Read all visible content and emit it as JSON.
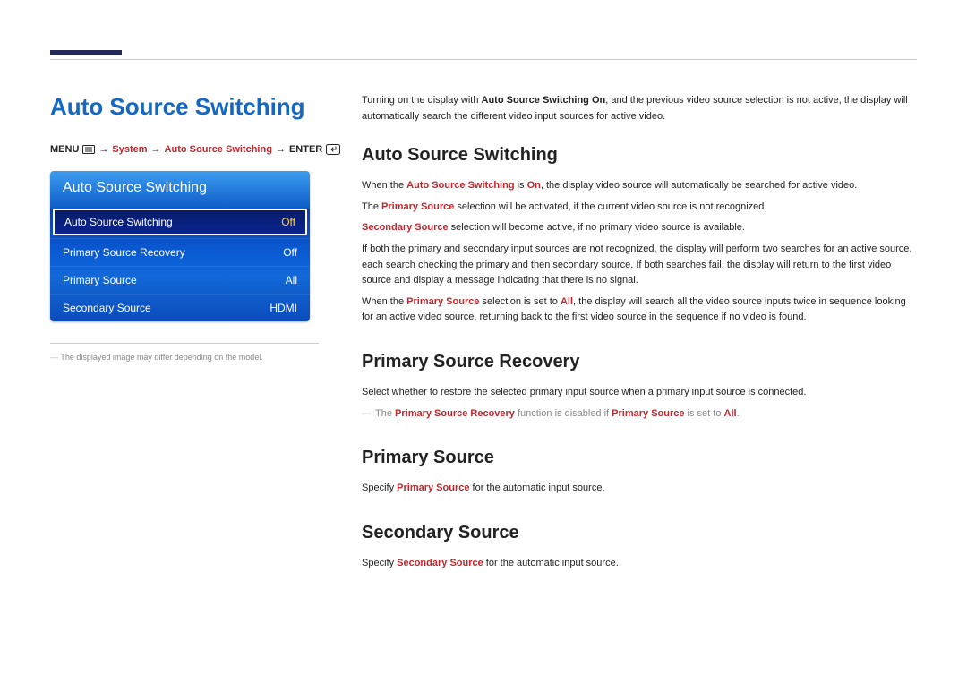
{
  "page_title": "Auto Source Switching",
  "breadcrumb": {
    "menu": "MENU",
    "arrow": "→",
    "system": "System",
    "item": "Auto Source Switching",
    "enter": "ENTER"
  },
  "osd": {
    "header": "Auto Source Switching",
    "rows": [
      {
        "label": "Auto Source Switching",
        "value": "Off",
        "selected": true
      },
      {
        "label": "Primary Source Recovery",
        "value": "Off",
        "selected": false
      },
      {
        "label": "Primary Source",
        "value": "All",
        "selected": false
      },
      {
        "label": "Secondary Source",
        "value": "HDMI",
        "selected": false
      }
    ]
  },
  "footnote": "The displayed image may differ depending on the model.",
  "intro": {
    "pre": "Turning on the display with ",
    "bold": "Auto Source Switching On",
    "post": ", and the previous video source selection is not active, the display will automatically search the different video input sources for active video."
  },
  "sections": {
    "ass": {
      "heading": "Auto Source Switching",
      "p1_pre": "When the ",
      "p1_b1": "Auto Source Switching",
      "p1_mid": " is ",
      "p1_b2": "On",
      "p1_post": ", the display video source will automatically be searched for active video.",
      "p2_pre": "The ",
      "p2_b": "Primary Source",
      "p2_post": " selection will be activated, if the current video source is not recognized.",
      "p3_b": "Secondary Source",
      "p3_post": " selection will become active, if no primary video source is available.",
      "p4": "If both the primary and secondary input sources are not recognized, the display will perform two searches for an active source, each search checking the primary and then secondary source. If both searches fail, the display will return to the first video source and display a message indicating that there is no signal.",
      "p5_pre": "When the ",
      "p5_b1": "Primary Source",
      "p5_mid": " selection is set to ",
      "p5_b2": "All",
      "p5_post": ", the display will search all the video source inputs twice in sequence looking for an active video source, returning back to the first video source in the sequence if no video is found."
    },
    "psr": {
      "heading": "Primary Source Recovery",
      "p1": "Select whether to restore the selected primary input source when a primary input source is connected.",
      "note_pre": "The ",
      "note_b1": "Primary Source Recovery",
      "note_mid": " function is disabled if ",
      "note_b2": "Primary Source",
      "note_mid2": " is set to ",
      "note_b3": "All",
      "note_post": "."
    },
    "ps": {
      "heading": "Primary Source",
      "p_pre": "Specify ",
      "p_b": "Primary Source",
      "p_post": " for the automatic input source."
    },
    "ss": {
      "heading": "Secondary Source",
      "p_pre": "Specify ",
      "p_b": "Secondary Source",
      "p_post": " for the automatic input source."
    }
  }
}
